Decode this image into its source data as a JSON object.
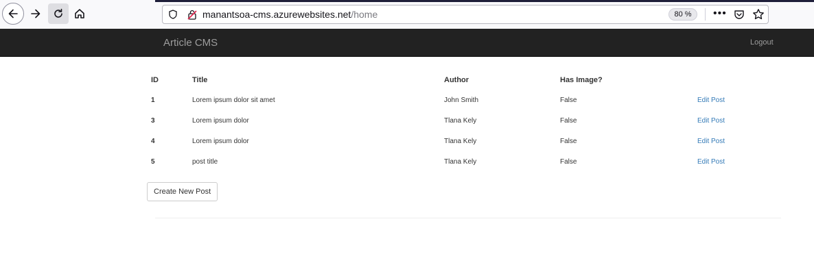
{
  "browser": {
    "url_host": "manantsoa-cms.azurewebsites.net",
    "url_path": "/home",
    "zoom": "80 %"
  },
  "navbar": {
    "brand": "Article CMS",
    "logout_label": "Logout"
  },
  "table": {
    "headers": [
      "ID",
      "Title",
      "Author",
      "Has Image?",
      ""
    ],
    "rows": [
      {
        "id": "1",
        "title": "Lorem ipsum dolor sit amet",
        "author": "John Smith",
        "has_image": "False",
        "action": "Edit Post"
      },
      {
        "id": "3",
        "title": "Lorem ipsum dolor",
        "author": "Tlana Kely",
        "has_image": "False",
        "action": "Edit Post"
      },
      {
        "id": "4",
        "title": "Lorem ipsum dolor",
        "author": "Tlana Kely",
        "has_image": "False",
        "action": "Edit Post"
      },
      {
        "id": "5",
        "title": "post title",
        "author": "Tlana Kely",
        "has_image": "False",
        "action": "Edit Post"
      }
    ]
  },
  "create_button_label": "Create New Post",
  "colors": {
    "navbar_bg": "#222222",
    "navbar_text": "#9d9d9d",
    "link": "#337ab7"
  }
}
